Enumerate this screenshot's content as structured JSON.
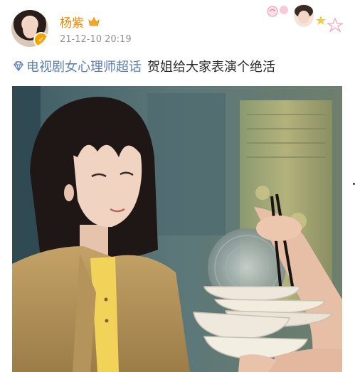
{
  "post": {
    "username": "杨紫",
    "timestamp": "21-12-10 20:19",
    "topic": "电视剧女心理师超话",
    "caption": "贺姐给大家表演个绝活"
  },
  "icons": {
    "crown": "crown-icon",
    "verified": "verified-badge-icon",
    "topic": "supertopic-diamond-icon",
    "decoration": "profile-card-decoration"
  },
  "colors": {
    "username": "#f08600",
    "topic": "#5b7fb0",
    "timestamp": "#939393"
  }
}
